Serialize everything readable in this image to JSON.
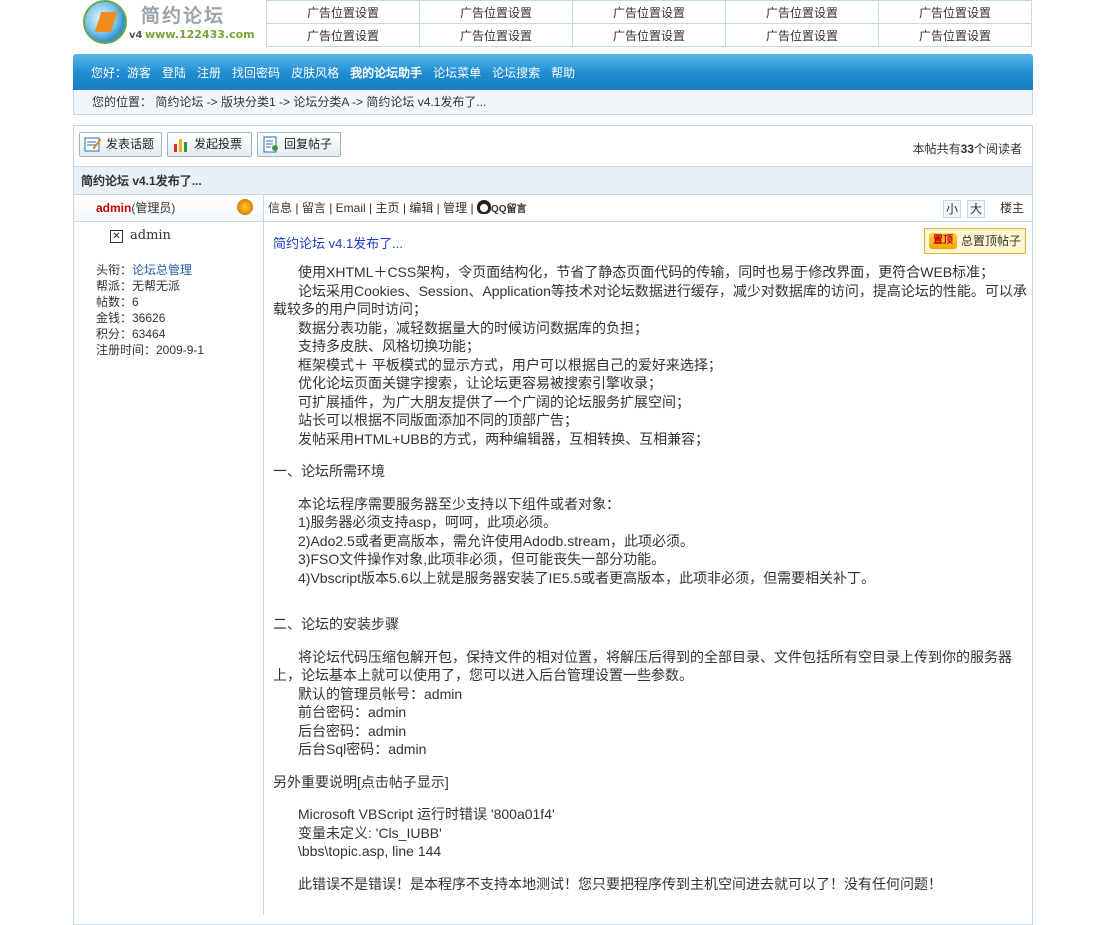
{
  "logo": {
    "title": "简约论坛",
    "version": "v4",
    "url": "www.122433.com"
  },
  "ads": [
    [
      "广告位置设置",
      "广告位置设置",
      "广告位置设置",
      "广告位置设置",
      "广告位置设置"
    ],
    [
      "广告位置设置",
      "广告位置设置",
      "广告位置设置",
      "广告位置设置",
      "广告位置设置"
    ]
  ],
  "nav": {
    "greeting": "您好：游客",
    "items": [
      "登陆",
      "注册",
      "找回密码",
      "皮肤风格",
      "我的论坛助手",
      "论坛菜单",
      "论坛搜索",
      "帮助"
    ]
  },
  "breadcrumb": "您的位置： 简约论坛 -> 版块分类1 -> 论坛分类A -> 简约论坛 v4.1发布了...",
  "toolbar": {
    "new_topic": "发表话题",
    "new_poll": "发起投票",
    "reply": "回复帖子",
    "readers_prefix": "本帖共有",
    "readers_count": "33",
    "readers_suffix": "个阅读者"
  },
  "topic_title": "简约论坛 v4.1发布了...",
  "user": {
    "name": "admin",
    "role": "(管理员)",
    "avatar_name": "admin",
    "title_label": "头衔：",
    "title_value": "论坛总管理",
    "faction": "帮派：无帮无派",
    "posts": "帖数：6",
    "money": "金钱：36626",
    "points": "积分：63464",
    "registered": "注册时间：2009-9-1"
  },
  "post_tools": {
    "info": "信息",
    "message": "留言",
    "email": "Email",
    "home": "主页",
    "edit": "编辑",
    "manage": "管理",
    "qq": "QQ留言",
    "small": "小",
    "large": "大",
    "floor": "楼主"
  },
  "post": {
    "title": "简约论坛 v4.1发布了...",
    "sticky_tag": "置顶",
    "sticky_label": "总置顶帖子",
    "features": [
      "使用XHTML＋CSS架构，令页面结构化，节省了静态页面代码的传输，同时也易于修改界面，更符合WEB标准；",
      "论坛采用Cookies、Session、Application等技术对论坛数据进行缓存，减少对数据库的访问，提高论坛的性能。可以承载较多的用户同时访问；",
      "数据分表功能，减轻数据量大的时候访问数据库的负担；",
      "支持多皮肤、风格切换功能；",
      "框架模式＋ 平板模式的显示方式，用户可以根据自己的爱好来选择；",
      "优化论坛页面关键字搜索，让论坛更容易被搜索引擎收录；",
      "可扩展插件，为广大朋友提供了一个广阔的论坛服务扩展空间；",
      "站长可以根据不同版面添加不同的顶部广告；",
      "发帖采用HTML+UBB的方式，两种编辑器，互相转换、互相兼容；"
    ],
    "section1_title": "一、论坛所需环境",
    "section1_intro": "本论坛程序需要服务器至少支持以下组件或者对象：",
    "section1_items": [
      "1)服务器必须支持asp，呵呵，此项必须。",
      "2)Ado2.5或者更高版本，需允许使用Adodb.stream，此项必须。",
      "3)FSO文件操作对象,此项非必须，但可能丧失一部分功能。",
      "4)Vbscript版本5.6以上就是服务器安装了IE5.5或者更高版本，此项非必须，但需要相关补丁。"
    ],
    "section2_title": "二、论坛的安装步骤",
    "section2_text": "将论坛代码压缩包解开包，保持文件的相对位置，将解压后得到的全部目录、文件包括所有空目录上传到你的服务器上，论坛基本上就可以使用了，您可以进入后台管理设置一些参数。",
    "section2_items": [
      "默认的管理员帐号：admin",
      "前台密码：admin",
      "后台密码：admin",
      "后台Sql密码：admin"
    ],
    "note_title": "另外重要说明[点击帖子显示]",
    "error_lines": [
      "Microsoft VBScript 运行时错误 '800a01f4'",
      "变量未定义: 'Cls_IUBB'",
      "\\bbs\\topic.asp, line 144"
    ],
    "closing": "此错误不是错误！是本程序不支持本地测试！您只要把程序传到主机空间进去就可以了！没有任何问题！"
  }
}
